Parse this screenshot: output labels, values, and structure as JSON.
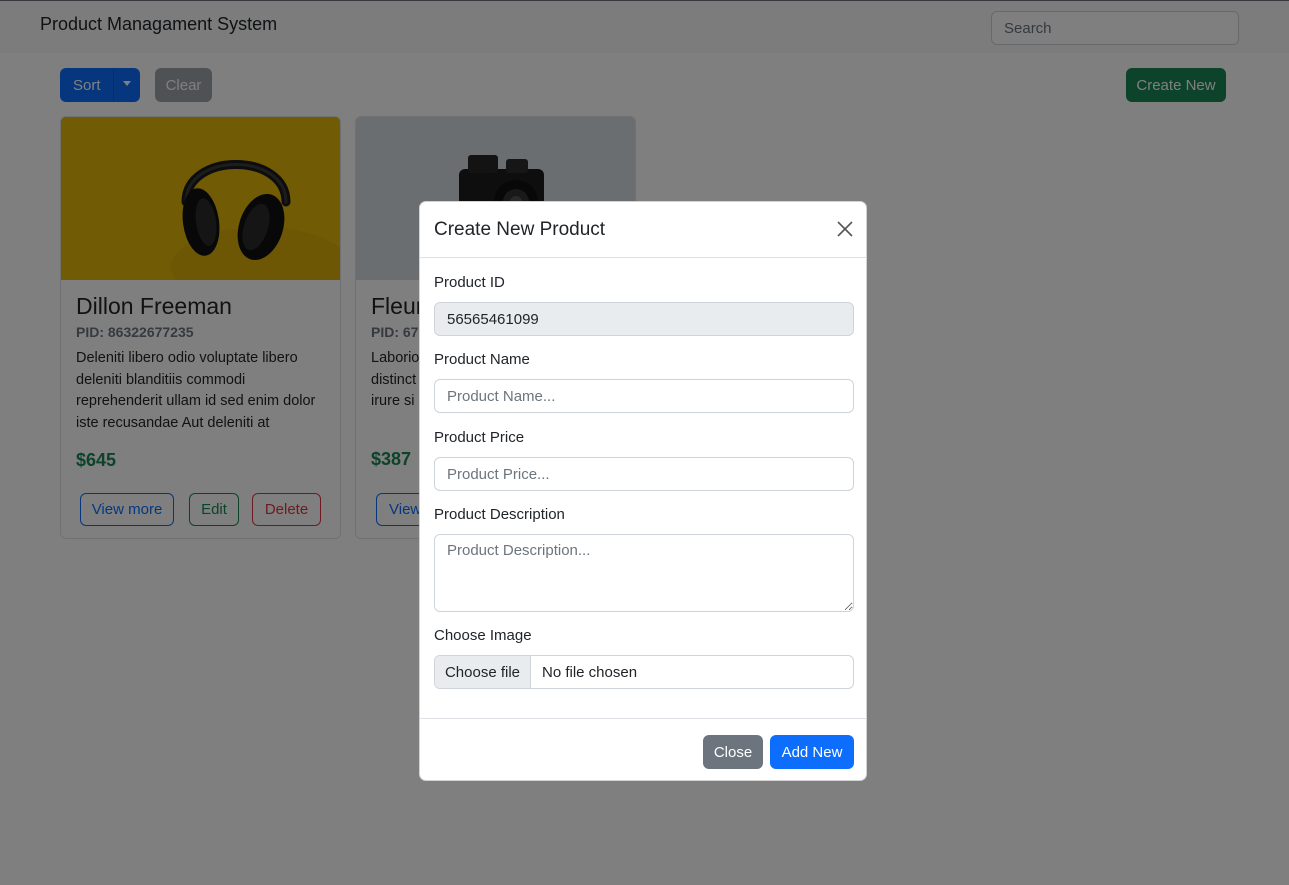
{
  "navbar": {
    "brand": "Product Managament System",
    "search_placeholder": "Search"
  },
  "toolbar": {
    "sort_label": "Sort",
    "clear_label": "Clear",
    "create_label": "Create New"
  },
  "products": [
    {
      "name": "Dillon Freeman",
      "pid": "PID: 86322677235",
      "description": "Deleniti libero odio voluptate libero deleniti blanditiis commodi reprehenderit ullam id sed enim dolor iste recusandae Aut deleniti at",
      "price": "$645",
      "image": "headphones-image"
    },
    {
      "name": "Fleur",
      "pid": "PID: 67",
      "description": "Laborio distinct irure si",
      "price": "$387",
      "image": "camera-image"
    }
  ],
  "card_buttons": {
    "view": "View more",
    "view_partial": "View",
    "edit": "Edit",
    "delete": "Delete"
  },
  "modal": {
    "title": "Create New Product",
    "product_id_label": "Product ID",
    "product_id_value": "56565461099",
    "product_name_label": "Product Name",
    "product_name_placeholder": "Product Name...",
    "product_price_label": "Product Price",
    "product_price_placeholder": "Product Price...",
    "product_description_label": "Product Description",
    "product_description_placeholder": "Product Description...",
    "image_label": "Choose Image",
    "choose_file_label": "Choose file",
    "no_file_label": "No file chosen",
    "close_label": "Close",
    "add_label": "Add New"
  },
  "colors": {
    "primary": "#0d6efd",
    "success": "#198754",
    "danger": "#dc3545",
    "secondary": "#6c757d"
  }
}
